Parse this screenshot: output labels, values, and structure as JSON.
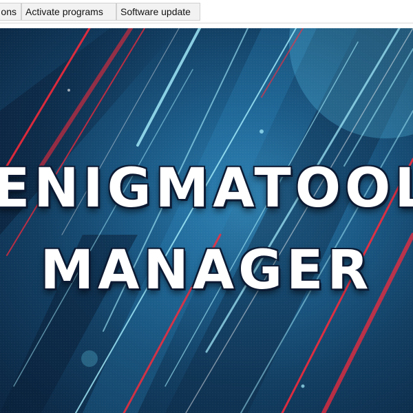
{
  "menubar": {
    "items": [
      {
        "label": "ons"
      },
      {
        "label": "Activate programs"
      },
      {
        "label": "Software update"
      }
    ]
  },
  "banner": {
    "line1": "ENIGMATOOL",
    "line2": "MANAGER",
    "colors": {
      "background": "#1c5d8a",
      "streak_red": "#ff2a3a",
      "streak_cyan": "#6fe3ff",
      "text": "#ffffff",
      "text_outline": "#0c1a33"
    }
  }
}
